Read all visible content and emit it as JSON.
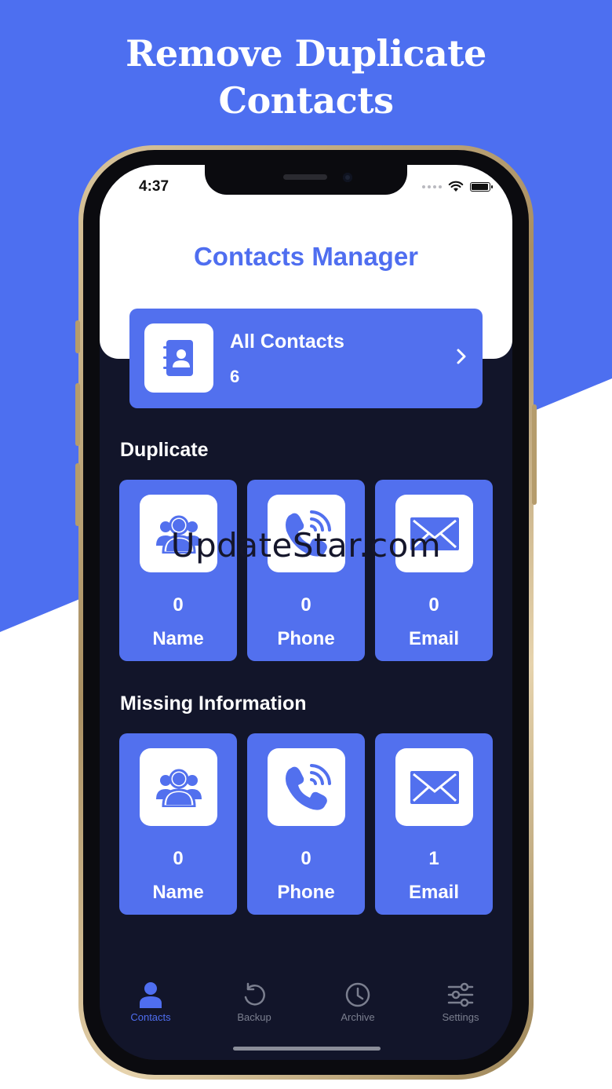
{
  "promo": {
    "headline_line1": "Remove Duplicate",
    "headline_line2": "Contacts"
  },
  "status_bar": {
    "time": "4:37"
  },
  "app": {
    "title": "Contacts Manager"
  },
  "all_contacts": {
    "label": "All Contacts",
    "count": "6",
    "icon": "address-book-icon"
  },
  "duplicate": {
    "title": "Duplicate",
    "tiles": [
      {
        "label": "Name",
        "count": "0",
        "icon": "people-icon"
      },
      {
        "label": "Phone",
        "count": "0",
        "icon": "phone-call-icon"
      },
      {
        "label": "Email",
        "count": "0",
        "icon": "envelope-icon"
      }
    ]
  },
  "missing": {
    "title": "Missing Information",
    "tiles": [
      {
        "label": "Name",
        "count": "0",
        "icon": "people-icon"
      },
      {
        "label": "Phone",
        "count": "0",
        "icon": "phone-call-icon"
      },
      {
        "label": "Email",
        "count": "1",
        "icon": "envelope-icon"
      }
    ]
  },
  "tabbar": {
    "items": [
      {
        "label": "Contacts",
        "icon": "person-icon",
        "active": true
      },
      {
        "label": "Backup",
        "icon": "restore-icon",
        "active": false
      },
      {
        "label": "Archive",
        "icon": "clock-icon",
        "active": false
      },
      {
        "label": "Settings",
        "icon": "sliders-icon",
        "active": false
      }
    ]
  },
  "watermark": "UpdateStar.com",
  "colors": {
    "accent": "#5270ee",
    "background_blue": "#4d6ff0",
    "screen_dark": "#12152a",
    "tab_inactive": "#7b7f8f"
  }
}
